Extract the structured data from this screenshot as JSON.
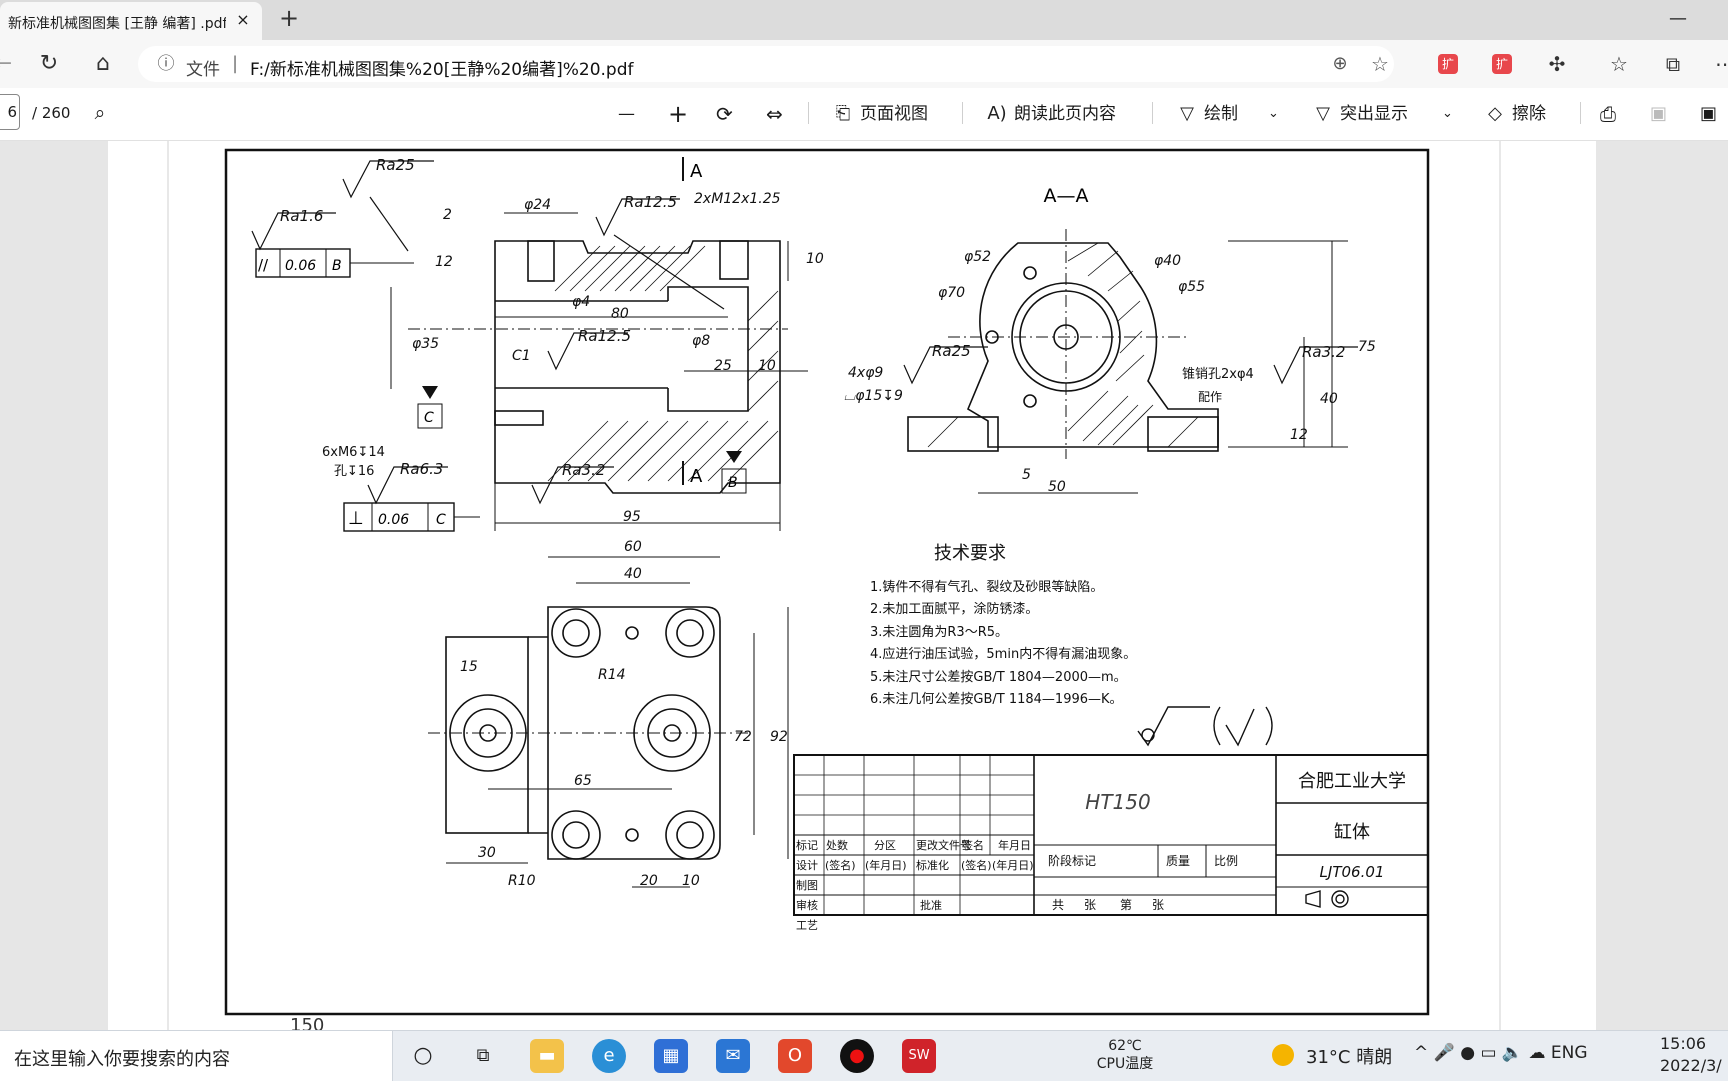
{
  "browser": {
    "tab_title": "新标准机械图图集 [王静 编著] .pdf",
    "tab_close": "×",
    "new_tab": "+",
    "minimize": "—",
    "nav": {
      "back": "←",
      "reload": "↻",
      "home": "⌂"
    },
    "address": {
      "prefix": "文件",
      "separator": "|",
      "url": "F:/新标准机械图图集%20[王静%20编著]%20.pdf"
    },
    "extensions": [
      "扩",
      "扩"
    ],
    "right_icons": [
      "puzzle-icon",
      "favorites-icon",
      "collections-icon",
      "more-icon"
    ]
  },
  "pdf_toolbar": {
    "page_current": "6",
    "page_total": "/ 260",
    "zoom_out": "—",
    "zoom_in": "+",
    "page_view": "页面视图",
    "read_aloud": "朗读此页内容",
    "draw": "绘制",
    "highlight": "突出显示",
    "erase": "擦除"
  },
  "drawing": {
    "page_number": "150",
    "view_label_section": "A—A",
    "section_mark": "A",
    "datum_b": "B",
    "datum_c": "C",
    "roughness": [
      "Ra25",
      "Ra1.6",
      "Ra12.5",
      "Ra12.5",
      "Ra3.2",
      "Ra6.3",
      "Ra25",
      "Ra3.2"
    ],
    "dimensions_front": [
      "φ24",
      "2xM12x1.25",
      "2",
      "12",
      "10",
      "φ4",
      "80",
      "φ35",
      "φ8",
      "25",
      "10",
      "C1",
      "95"
    ],
    "tolerance_parallel": {
      "symbol": "//",
      "value": "0.06",
      "datum": "B"
    },
    "tolerance_perp": {
      "symbol": "⊥",
      "value": "0.06",
      "datum": "C"
    },
    "thread_note": [
      "6xM6↧14",
      "孔↧16"
    ],
    "dimensions_side": [
      "φ52",
      "φ40",
      "φ70",
      "φ55",
      "4xφ9",
      "⌴φ15↧9",
      "锥销孔2xφ4",
      "配作",
      "75",
      "40",
      "12",
      "5",
      "50"
    ],
    "dimensions_top": [
      "60",
      "40",
      "15",
      "R14",
      "72",
      "92",
      "65",
      "30",
      "R10",
      "20",
      "10"
    ],
    "tech_requirements": {
      "title": "技术要求",
      "items": [
        "1.铸件不得有气孔、裂纹及砂眼等缺陷。",
        "2.未加工面腻平，涂防锈漆。",
        "3.未注圆角为R3～R5。",
        "4.应进行油压试验，5min内不得有漏油现象。",
        "5.未注尺寸公差按GB/T 1804—2000—m。",
        "6.未注几何公差按GB/T 1184—1996—K。"
      ]
    },
    "title_block": {
      "material": "HT150",
      "school": "合肥工业大学",
      "part_name": "缸体",
      "drawing_no": "LJT06.01",
      "header_row": [
        "标记",
        "处数",
        "分区",
        "更改文件号",
        "签名",
        "年月日"
      ],
      "row_design": [
        "设计",
        "(签名)",
        "(年月日)",
        "标准化",
        "(签名)",
        "(年月日)"
      ],
      "rows": [
        "制图",
        "审核",
        "工艺"
      ],
      "approve": "批准",
      "stage": "阶段标记",
      "mass": "质量",
      "scale": "比例",
      "sheets": [
        "共",
        "张",
        "第",
        "张"
      ]
    }
  },
  "taskbar": {
    "search_text": "在这里输入你要搜索的内容",
    "cpu_temp_value": "62℃",
    "cpu_temp_label": "CPU温度",
    "weather": "31°C  晴朗",
    "tray": "^  🎤  ●  ▭  🔈  ☁  ENG",
    "time": "15:06",
    "date": "2022/3/"
  }
}
